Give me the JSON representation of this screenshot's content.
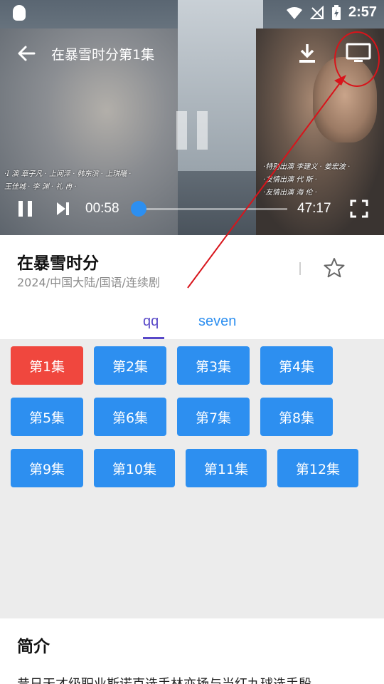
{
  "status_bar": {
    "time": "2:57"
  },
  "player": {
    "title": "在暴雪时分第1集",
    "current_time": "00:58",
    "total_time": "47:17",
    "progress_fraction": 0.02,
    "subtitles_left": [
      "·I  演  章子凡 · 上闻泽 · 韩东滨 · 上琪曦 ·",
      "  王佳城 ·  李  渊  ·  礼  冉 ·"
    ],
    "subtitles_right": [
      "·特别出演  李建义 · 姜宏波 ·",
      "·友情出演  代  斯 ·",
      "·友情出演  海  伦 ·"
    ]
  },
  "show": {
    "title": "在暴雪时分",
    "meta": "2024/中国大陆/国语/连续剧"
  },
  "tabs": [
    {
      "label": "qq",
      "active": true
    },
    {
      "label": "seven",
      "active": false
    }
  ],
  "episodes": [
    "第1集",
    "第2集",
    "第3集",
    "第4集",
    "第5集",
    "第6集",
    "第7集",
    "第8集",
    "第9集",
    "第10集",
    "第11集",
    "第12集"
  ],
  "active_episode": "第1集",
  "intro": {
    "title": "简介",
    "text": "昔日天才级职业斯诺克选手林亦扬与当红九球选手殷"
  },
  "colors": {
    "accent_blue": "#2d8ff0",
    "active_red": "#f0473e",
    "tab_purple": "#5848c8",
    "annotation_red": "#d8141b"
  },
  "icons": {
    "back": "back-arrow-icon",
    "download": "download-icon",
    "cast": "cast-screen-icon",
    "favorite": "star-outline-icon",
    "fullscreen": "fullscreen-icon"
  }
}
